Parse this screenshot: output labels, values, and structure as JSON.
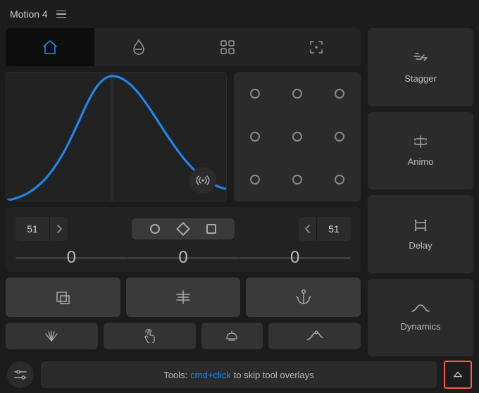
{
  "app": {
    "title": "Motion 4"
  },
  "tabs": [
    "home",
    "drop",
    "grid",
    "focus"
  ],
  "curve": {
    "broadcast_icon": "broadcast"
  },
  "values": {
    "left": "51",
    "right": "51"
  },
  "sidebar": {
    "stagger": {
      "label": "Stagger"
    },
    "animo": {
      "label": "Animo"
    },
    "delay": {
      "label": "Delay"
    },
    "dynamics": {
      "label": "Dynamics"
    }
  },
  "footer": {
    "prefix": "Tools:",
    "highlight": "cmd+click",
    "suffix": "to skip tool overlays"
  }
}
